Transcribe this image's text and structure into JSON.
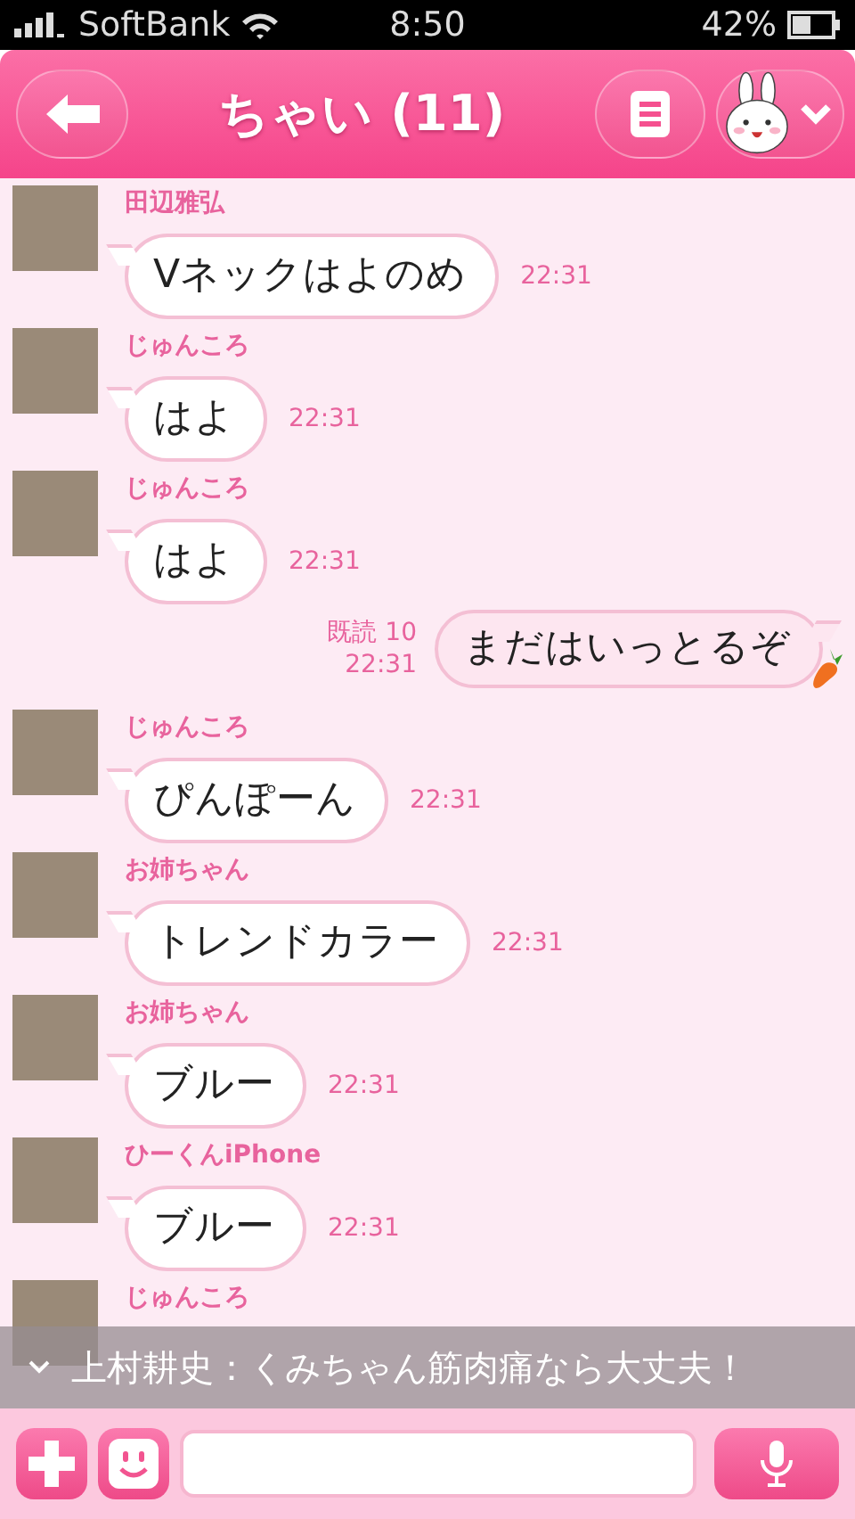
{
  "status_bar": {
    "carrier": "SoftBank",
    "time": "8:50",
    "battery": "42%"
  },
  "header": {
    "title": "ちゃい (11)"
  },
  "messages": [
    {
      "kind": "incoming",
      "sender": "田辺雅弘",
      "text": "Vネックはよのめ",
      "time": "22:31"
    },
    {
      "kind": "incoming",
      "sender": "じゅんころ",
      "text": "はよ",
      "time": "22:31"
    },
    {
      "kind": "incoming",
      "sender": "じゅんころ",
      "text": "はよ",
      "time": "22:31"
    },
    {
      "kind": "outgoing",
      "read": "既読 10",
      "text": "まだはいっとるぞ",
      "time": "22:31"
    },
    {
      "kind": "incoming",
      "sender": "じゅんころ",
      "text": "ぴんぽーん",
      "time": "22:31"
    },
    {
      "kind": "incoming",
      "sender": "お姉ちゃん",
      "text": "トレンドカラー",
      "time": "22:31"
    },
    {
      "kind": "incoming",
      "sender": "お姉ちゃん",
      "text": "ブルー",
      "time": "22:31"
    },
    {
      "kind": "incoming",
      "sender": "ひーくんiPhone",
      "text": "ブルー",
      "time": "22:31"
    },
    {
      "kind": "incoming",
      "sender": "じゅんころ"
    }
  ],
  "notification": {
    "text": "上村耕史：くみちゃん筋肉痛なら大丈夫！"
  }
}
